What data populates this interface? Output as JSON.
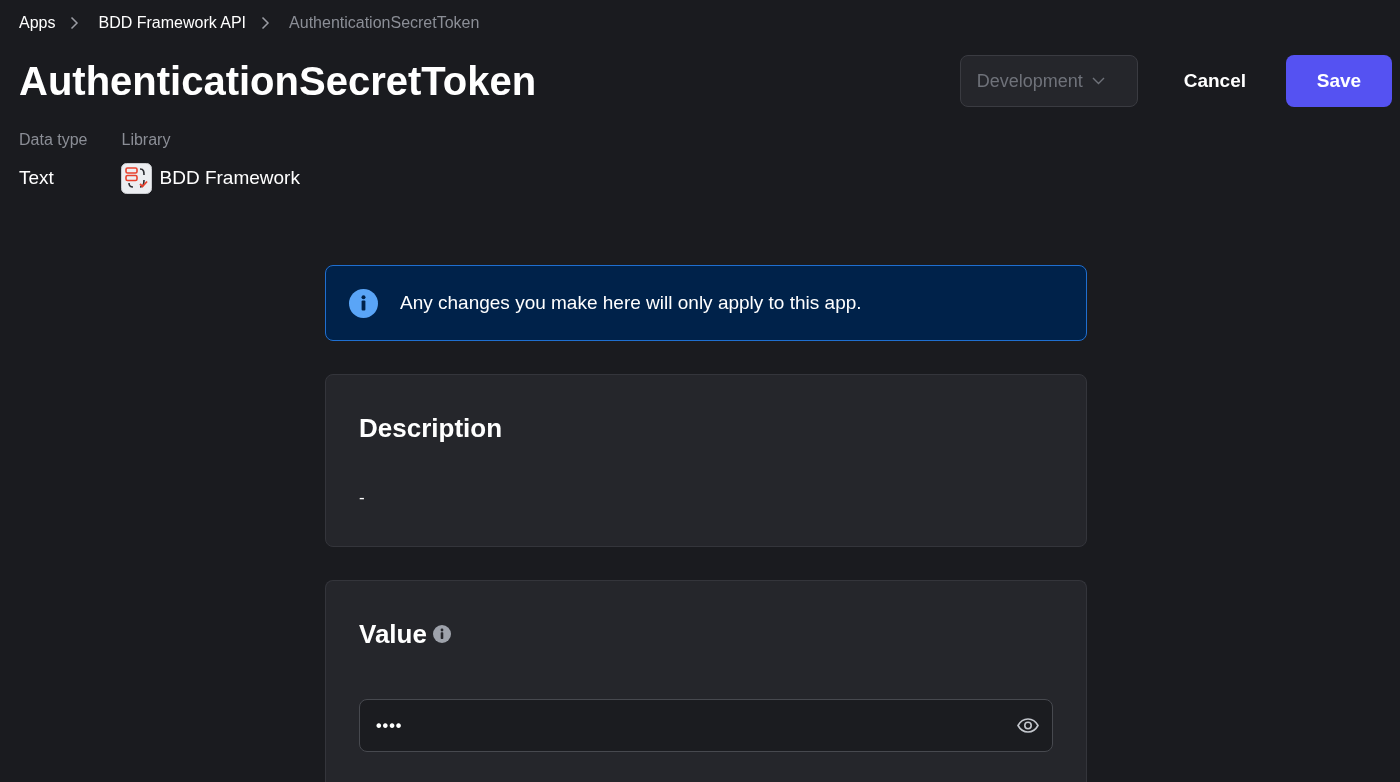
{
  "breadcrumbs": [
    {
      "label": "Apps",
      "current": false
    },
    {
      "label": "BDD Framework API",
      "current": false
    },
    {
      "label": "AuthenticationSecretToken",
      "current": true
    }
  ],
  "header": {
    "title": "AuthenticationSecretToken",
    "environment_dropdown": {
      "value": "Development",
      "disabled": true
    },
    "buttons": [
      {
        "label": "Cancel",
        "kind": "text"
      },
      {
        "label": "Save",
        "kind": "primary"
      }
    ]
  },
  "meta": [
    {
      "label": "Data type",
      "value": "Text",
      "kind": "plain"
    },
    {
      "label": "Library",
      "value": "BDD Framework",
      "kind": "library"
    }
  ],
  "notice": {
    "text": "Any changes you make here will only apply to this app."
  },
  "description": {
    "heading": "Description",
    "text": "-"
  },
  "value": {
    "heading": "Value",
    "field": {
      "value": "••••"
    }
  }
}
